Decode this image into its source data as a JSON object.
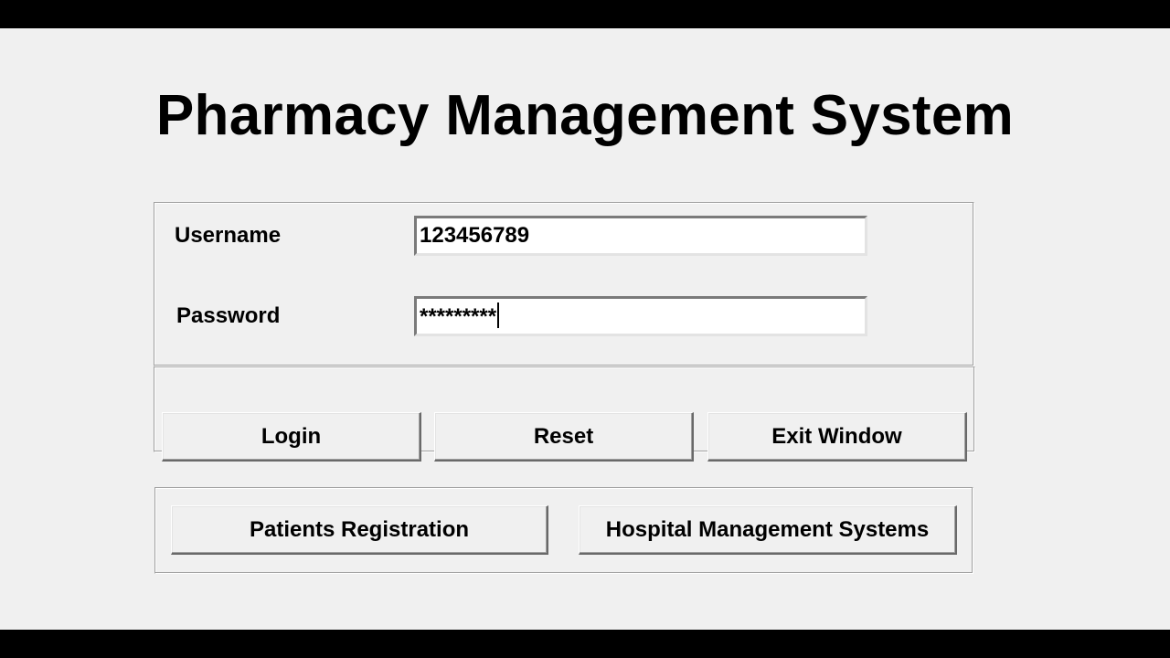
{
  "app": {
    "title": "Pharmacy Management System"
  },
  "login": {
    "username_label": "Username",
    "username_value": "123456789",
    "password_label": "Password",
    "password_value": "*********"
  },
  "actions": {
    "login_label": "Login",
    "reset_label": "Reset",
    "exit_label": "Exit Window"
  },
  "links": {
    "patients_label": "Patients Registration",
    "hospital_label": "Hospital Management Systems"
  },
  "colors": {
    "background": "#f0f0f0",
    "letterbox": "#000000",
    "entry_background": "#ffffff"
  }
}
